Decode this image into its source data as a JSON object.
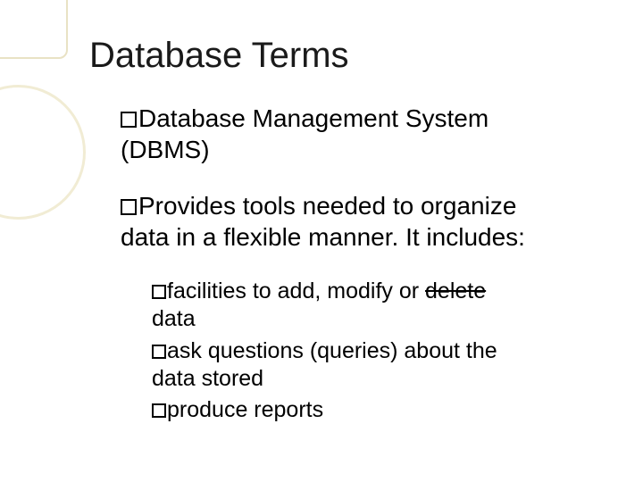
{
  "slide": {
    "title": "Database Terms",
    "top1_a": "Database Management System",
    "top1_b": "(DBMS)",
    "top2_a": "Provides tools needed to organize",
    "top2_b": "data in a flexible manner. It includes:",
    "sub1_a": "facilities to add, modify or ",
    "sub1_strike": "delete",
    "sub1_b": "data",
    "sub2_a": "ask questions (queries) about the",
    "sub2_b": "data stored",
    "sub3": "produce reports"
  }
}
